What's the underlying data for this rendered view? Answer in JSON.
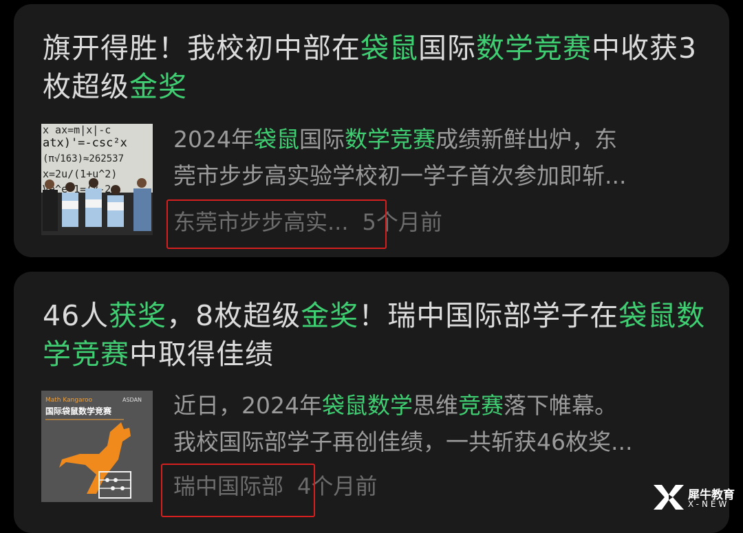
{
  "articles": [
    {
      "title_parts": [
        {
          "text": "旗开得胜！我校初中部在",
          "hl": false
        },
        {
          "text": "袋鼠",
          "hl": true
        },
        {
          "text": "国际",
          "hl": false
        },
        {
          "text": "数学竞赛",
          "hl": true
        },
        {
          "text": "中收获3枚超级",
          "hl": false
        },
        {
          "text": "金奖",
          "hl": true
        }
      ],
      "snippet_line1_parts": [
        {
          "text": "2024年",
          "hl": false
        },
        {
          "text": "袋鼠",
          "hl": true
        },
        {
          "text": "国际",
          "hl": false
        },
        {
          "text": "数学竞赛",
          "hl": true
        },
        {
          "text": "成绩新鲜出炉，东",
          "hl": false
        }
      ],
      "snippet_line2": "莞市步步高实验学校初一学子首次参加即斩...",
      "source": "东莞市步步高实...",
      "time": "5个月前",
      "thumbnail_board_text": [
        "x ax=m|x|-c",
        "atx)'=-csc²x",
        "(π√163)≈262537",
        "x=2u/(1+u^2)",
        "Ve^e+1=(x-2"
      ],
      "thumbnail_alt": "students holding certificates photo"
    },
    {
      "title_parts": [
        {
          "text": "46人",
          "hl": false
        },
        {
          "text": "获奖",
          "hl": true
        },
        {
          "text": "，8枚超级",
          "hl": false
        },
        {
          "text": "金奖",
          "hl": true
        },
        {
          "text": "！瑞中国际部学子在",
          "hl": false
        },
        {
          "text": "袋鼠数学竞赛",
          "hl": true
        },
        {
          "text": "中取得佳绩",
          "hl": false
        }
      ],
      "snippet_line1_parts": [
        {
          "text": "近日，2024年",
          "hl": false
        },
        {
          "text": "袋鼠数学",
          "hl": true
        },
        {
          "text": "思维",
          "hl": false
        },
        {
          "text": "竞赛",
          "hl": true
        },
        {
          "text": "落下帷幕。",
          "hl": false
        }
      ],
      "snippet_line2": "我校国际部学子再创佳绩，一共斩获46枚奖...",
      "source": "瑞中国际部",
      "time": "4个月前",
      "thumbnail_header": "Math Kangaroo",
      "thumbnail_title": "国际袋鼠数学竞赛",
      "thumbnail_brand": "ASDAN",
      "thumbnail_alt": "orange kangaroo poster"
    }
  ],
  "watermark": {
    "name": "犀牛教育",
    "sub": "X-NEW"
  },
  "colors": {
    "background": "#000000",
    "card": "#1b1b1b",
    "title": "#dcdcdc",
    "highlight": "#3fcf72",
    "snippet": "#9b9b9b",
    "meta": "#6d6d6d",
    "annotation_box": "#d61f1f"
  }
}
